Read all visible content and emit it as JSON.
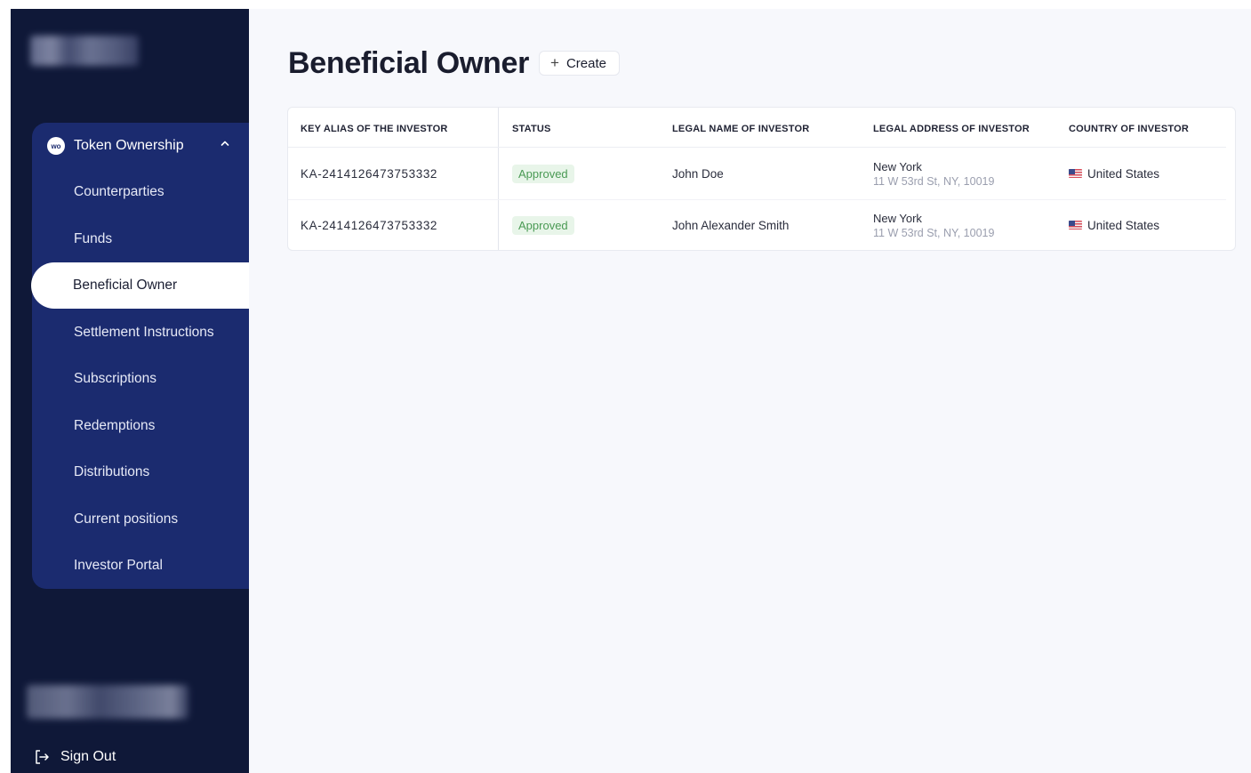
{
  "sidebar": {
    "group": {
      "icon_text": "wo",
      "label": "Token Ownership",
      "expanded": true
    },
    "items": [
      {
        "label": "Counterparties",
        "active": false
      },
      {
        "label": "Funds",
        "active": false
      },
      {
        "label": "Beneficial Owner",
        "active": true
      },
      {
        "label": "Settlement Instructions",
        "active": false
      },
      {
        "label": "Subscriptions",
        "active": false
      },
      {
        "label": "Redemptions",
        "active": false
      },
      {
        "label": "Distributions",
        "active": false
      },
      {
        "label": "Current positions",
        "active": false
      },
      {
        "label": "Investor Portal",
        "active": false
      }
    ],
    "sign_out_label": "Sign Out"
  },
  "main": {
    "title": "Beneficial Owner",
    "create_label": "Create",
    "table": {
      "columns": [
        "KEY ALIAS OF THE INVESTOR",
        "STATUS",
        "LEGAL NAME OF INVESTOR",
        "LEGAL ADDRESS OF INVESTOR",
        "COUNTRY OF INVESTOR"
      ],
      "rows": [
        {
          "key_alias": "KA-2414126473753332",
          "status": "Approved",
          "legal_name": "John Doe",
          "address_city": "New York",
          "address_street": "11 W 53rd St, NY, 10019",
          "country": "United States"
        },
        {
          "key_alias": "KA-2414126473753332",
          "status": "Approved",
          "legal_name": "John Alexander Smith",
          "address_city": "New York",
          "address_street": "11 W 53rd St, NY, 10019",
          "country": "United States"
        }
      ]
    }
  },
  "colors": {
    "sidebar_bg": "#0f1838",
    "nav_group_bg": "#1b2b6f",
    "main_bg": "#f7f8fc",
    "approved_bg": "#e8f5e9",
    "approved_text": "#4a9a54"
  },
  "icons": {
    "group": "token-ownership-icon",
    "chevron": "chevron-up-icon",
    "sign_out": "sign-out-icon",
    "create": "plus-icon",
    "flag": "us-flag-icon"
  }
}
